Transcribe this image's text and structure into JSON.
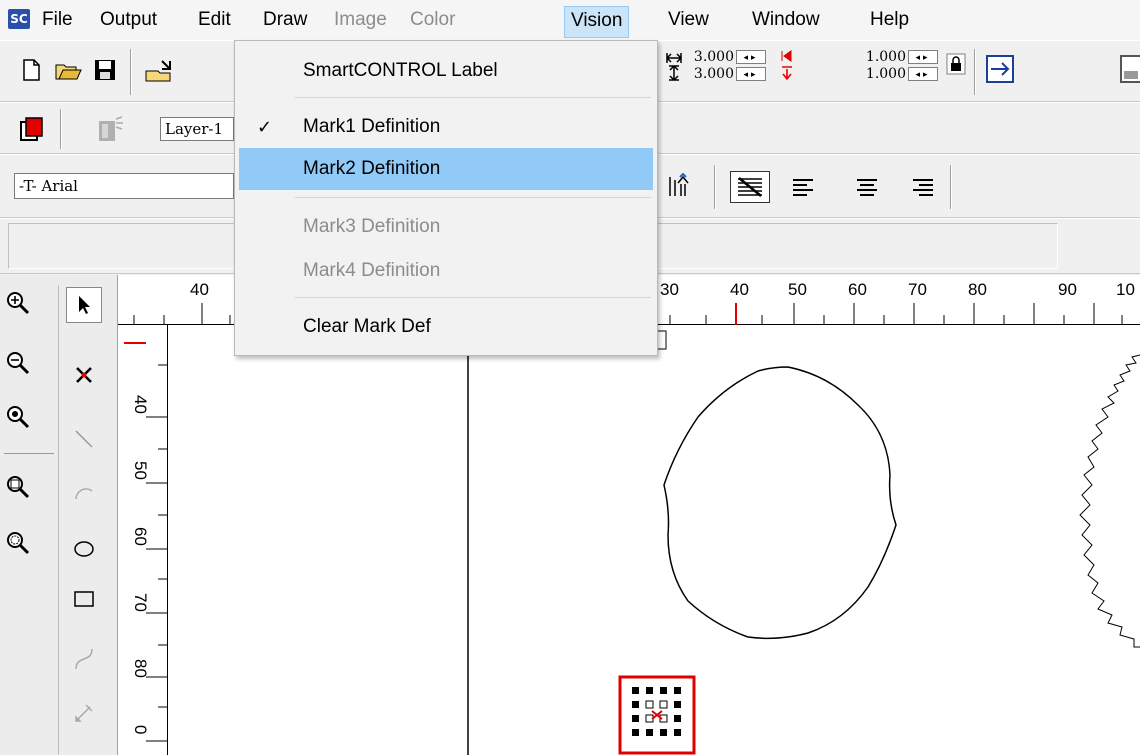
{
  "app": {
    "logo_text": "SC"
  },
  "menubar": {
    "items": [
      {
        "label": "File",
        "enabled": true
      },
      {
        "label": "Output",
        "enabled": true
      },
      {
        "label": "Edit",
        "enabled": true
      },
      {
        "label": "Draw",
        "enabled": true
      },
      {
        "label": "Image",
        "enabled": false
      },
      {
        "label": "Color",
        "enabled": false
      },
      {
        "label": "Vision",
        "enabled": true,
        "open": true
      },
      {
        "label": "View",
        "enabled": true
      },
      {
        "label": "Window",
        "enabled": true
      },
      {
        "label": "Help",
        "enabled": true
      }
    ]
  },
  "vision_menu": {
    "items": [
      {
        "label": "SmartCONTROL Label",
        "enabled": true,
        "checked": false
      },
      {
        "label": "Mark1 Definition",
        "enabled": true,
        "checked": true
      },
      {
        "label": "Mark2 Definition",
        "enabled": true,
        "checked": false,
        "highlighted": true
      },
      {
        "label": "Mark3 Definition",
        "enabled": false,
        "checked": false
      },
      {
        "label": "Mark4 Definition",
        "enabled": false,
        "checked": false
      },
      {
        "label": "Clear Mark Def",
        "enabled": true,
        "checked": false
      }
    ]
  },
  "toolbar": {
    "layer_value": "Layer-1",
    "font_value": "-T- Arial",
    "width_value": "3.000",
    "height_value": "3.000",
    "scale_x_value": "1.000",
    "scale_y_value": "1.000"
  },
  "ruler": {
    "h_labels": [
      "40",
      "30",
      "40",
      "50",
      "60",
      "70",
      "80",
      "90",
      "10"
    ],
    "v_labels": [
      "40",
      "50",
      "60",
      "70",
      "80",
      "0"
    ]
  },
  "colors": {
    "accent": "#91c9f7",
    "marker": "#e00000",
    "menu_open": "#cce4f7"
  },
  "icons": [
    "new-file-icon",
    "open-folder-icon",
    "save-icon",
    "lock-icon",
    "zoom-in-icon",
    "zoom-out-icon",
    "select-arrow-icon",
    "delete-x-icon",
    "line-icon",
    "ellipse-icon",
    "rectangle-icon",
    "curve-icon"
  ]
}
